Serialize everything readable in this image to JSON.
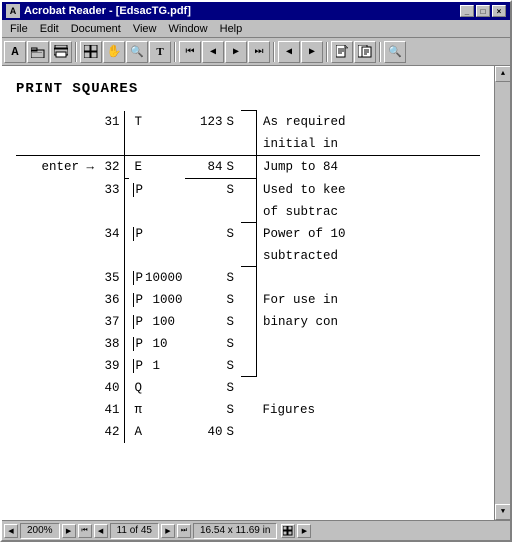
{
  "window": {
    "title": "Acrobat Reader - [EdsacTG.pdf]",
    "icon": "A"
  },
  "menu": {
    "items": [
      "File",
      "Edit",
      "Document",
      "View",
      "Window",
      "Help"
    ]
  },
  "document": {
    "title": "PRINT SQUARES",
    "rows": [
      {
        "label": "",
        "num": "31",
        "code": "T",
        "val": "123",
        "s": "S",
        "bracket": "top",
        "desc": "As required"
      },
      {
        "label": "",
        "num": "",
        "code": "",
        "val": "",
        "s": "",
        "bracket": "bot",
        "desc": "initial in"
      },
      {
        "label": "enter →",
        "num": "32",
        "code": "E",
        "val": "84",
        "s": "S",
        "bracket": "single",
        "desc": "Jump to 84"
      },
      {
        "label": "",
        "num": "33",
        "code": "P",
        "val": "",
        "s": "S",
        "bracket": "top",
        "desc": "Used to kee"
      },
      {
        "label": "",
        "num": "",
        "code": "",
        "val": "",
        "s": "",
        "bracket": "bot",
        "desc": "of subtrac"
      },
      {
        "label": "",
        "num": "34",
        "code": "P",
        "val": "",
        "s": "S",
        "bracket": "top",
        "desc": "Power of 10"
      },
      {
        "label": "",
        "num": "",
        "code": "",
        "val": "",
        "s": "",
        "bracket": "bot",
        "desc": "subtracted"
      },
      {
        "label": "",
        "num": "35",
        "code": "P",
        "val": "10000",
        "s": "S",
        "bracket": "top",
        "desc": ""
      },
      {
        "label": "",
        "num": "36",
        "code": "P",
        "val": "1000",
        "s": "S",
        "bracket": "mid",
        "desc": "For use in"
      },
      {
        "label": "",
        "num": "37",
        "code": "P",
        "val": "100",
        "s": "S",
        "bracket": "mid",
        "desc": "binary con"
      },
      {
        "label": "",
        "num": "38",
        "code": "P",
        "val": "10",
        "s": "S",
        "bracket": "mid",
        "desc": ""
      },
      {
        "label": "",
        "num": "39",
        "code": "P",
        "val": "1",
        "s": "S",
        "bracket": "bot",
        "desc": ""
      },
      {
        "label": "",
        "num": "40",
        "code": "Q",
        "val": "",
        "s": "S",
        "bracket": "",
        "desc": ""
      },
      {
        "label": "",
        "num": "41",
        "code": "π",
        "val": "",
        "s": "S",
        "bracket": "",
        "desc": "Figures"
      },
      {
        "label": "",
        "num": "42",
        "code": "A",
        "val": "40",
        "s": "S",
        "bracket": "",
        "desc": ""
      }
    ]
  },
  "statusbar": {
    "zoom": "200%",
    "page": "11 of 45",
    "size": "16.54 x 11.69 in"
  },
  "toolbar": {
    "buttons": [
      "A",
      "📂",
      "🖨",
      "▦",
      "✋",
      "🔍",
      "T",
      "⏮",
      "◀",
      "▶",
      "⏭",
      "◀",
      "▶",
      "📄",
      "📋",
      "🔍"
    ]
  }
}
